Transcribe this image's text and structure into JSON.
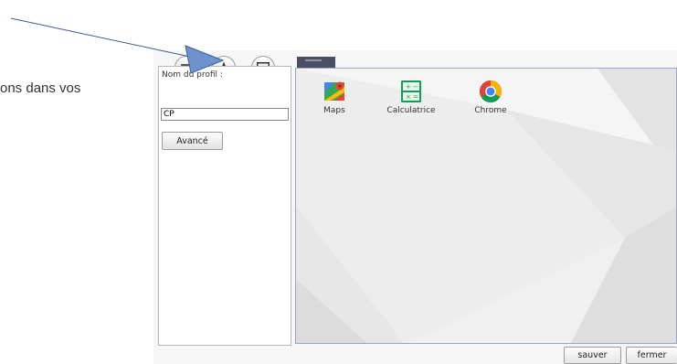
{
  "background_text": "ons dans vos",
  "toolbar": {
    "buttons": [
      {
        "name": "apps-mode",
        "icon": "apps-icon"
      },
      {
        "name": "favorites-mode",
        "icon": "star-icon"
      },
      {
        "name": "wallpaper-mode",
        "icon": "image-icon"
      }
    ]
  },
  "profile": {
    "label": "Nom du profil :",
    "value": "CP",
    "advanced_label": "Avancé"
  },
  "preview": {
    "apps": [
      {
        "label": "Maps",
        "icon": "maps-icon"
      },
      {
        "label": "Calculatrice",
        "icon": "calculator-icon"
      },
      {
        "label": "Chrome",
        "icon": "chrome-icon"
      }
    ]
  },
  "footer": {
    "save_label": "sauver",
    "close_label": "fermer"
  },
  "colors": {
    "arrow_fill": "#6d92cc",
    "arrow_stroke": "#3a5f9a",
    "preview_tab": "#4b4f63",
    "preview_border": "#9aa6c6"
  }
}
